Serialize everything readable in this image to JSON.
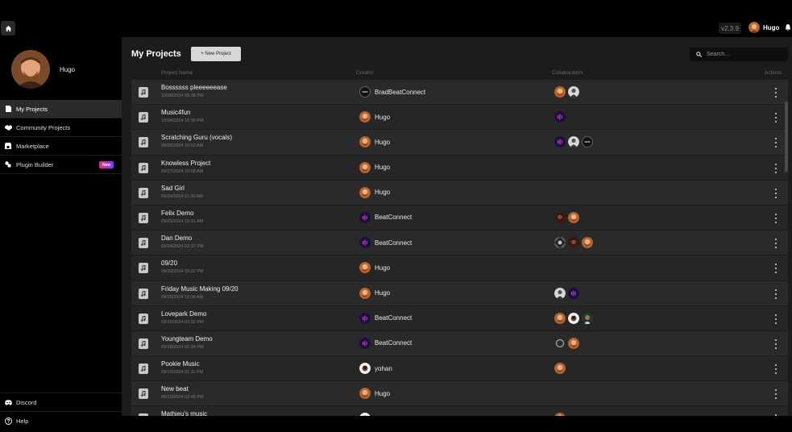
{
  "top": {
    "version": "v2.3.9",
    "user": "Hugo"
  },
  "sidebar": {
    "username": "Hugo",
    "items": [
      {
        "label": "My Projects",
        "icon": "file-icon",
        "active": true
      },
      {
        "label": "Community Projects",
        "icon": "handshake-icon",
        "active": false
      },
      {
        "label": "Marketplace",
        "icon": "store-icon",
        "active": false
      },
      {
        "label": "Plugin Builder",
        "icon": "plugin-icon",
        "active": false,
        "badge": "New"
      }
    ],
    "bottom": [
      {
        "label": "Discord",
        "icon": "discord-icon"
      },
      {
        "label": "Help",
        "icon": "help-icon"
      }
    ]
  },
  "main": {
    "title": "My Projects",
    "new_project": "+ New Project",
    "search_placeholder": "Search...",
    "columns": {
      "name": "Project Name",
      "creator": "Creator",
      "collaborators": "Collaborators",
      "actions": "Actions"
    },
    "projects": [
      {
        "name": "Bossssss pleeeeeease",
        "date": "10/08/2024 05:38 PM",
        "creator": "BradBeatConnect",
        "creator_avatar": "dark",
        "collaborators": [
          "hugo",
          "grey"
        ]
      },
      {
        "name": "Music4fun",
        "date": "10/04/2024 10:39 PM",
        "creator": "Hugo",
        "creator_avatar": "hugo",
        "collaborators": [
          "purple"
        ]
      },
      {
        "name": "Scratching Guru (vocals)",
        "date": "09/30/2024 10:53 AM",
        "creator": "Hugo",
        "creator_avatar": "hugo",
        "collaborators": [
          "purple",
          "grey",
          "dark"
        ]
      },
      {
        "name": "Knowless Project",
        "date": "09/27/2024 10:08 AM",
        "creator": "Hugo",
        "creator_avatar": "hugo",
        "collaborators": []
      },
      {
        "name": "Sad Girl",
        "date": "09/26/2024 11:30 AM",
        "creator": "Hugo",
        "creator_avatar": "hugo",
        "collaborators": []
      },
      {
        "name": "Felix Demo",
        "date": "09/25/2024 10:31 AM",
        "creator": "BeatConnect",
        "creator_avatar": "purple",
        "collaborators": [
          "brown",
          "hugo"
        ]
      },
      {
        "name": "Dan Demo",
        "date": "09/24/2024 02:37 PM",
        "creator": "BeatConnect",
        "creator_avatar": "purple",
        "collaborators": [
          "mixed",
          "brown",
          "hugo"
        ]
      },
      {
        "name": "09/20",
        "date": "09/20/2024 09:22 PM",
        "creator": "Hugo",
        "creator_avatar": "hugo",
        "collaborators": []
      },
      {
        "name": "Friday Music Making 09/20",
        "date": "09/20/2024 10:34 AM",
        "creator": "Hugo",
        "creator_avatar": "hugo",
        "collaborators": [
          "grey",
          "purple"
        ]
      },
      {
        "name": "Lovepark Demo",
        "date": "09/18/2024 03:32 PM",
        "creator": "BeatConnect",
        "creator_avatar": "purple",
        "collaborators": [
          "hugo",
          "white",
          "green"
        ]
      },
      {
        "name": "Youngteam Demo",
        "date": "09/18/2024 01:34 PM",
        "creator": "BeatConnect",
        "creator_avatar": "purple",
        "collaborators": [
          "darkgrey",
          "hugo"
        ]
      },
      {
        "name": "Pookie Music",
        "date": "09/15/2024 01:11 PM",
        "creator": "yohan",
        "creator_avatar": "white",
        "collaborators": [
          "hugo"
        ]
      },
      {
        "name": "New beat",
        "date": "09/12/2024 03:45 PM",
        "creator": "Hugo",
        "creator_avatar": "hugo",
        "collaborators": []
      },
      {
        "name": "Mathieu's music",
        "date": "",
        "creator": "",
        "creator_avatar": "white",
        "collaborators": [
          "hugo"
        ]
      }
    ]
  },
  "colors": {
    "background": "#000000",
    "panel": "#1c1c1c",
    "row": "#2a2a2a",
    "accent_gradient_start": "#e8306b",
    "accent_gradient_end": "#7b3cff"
  }
}
